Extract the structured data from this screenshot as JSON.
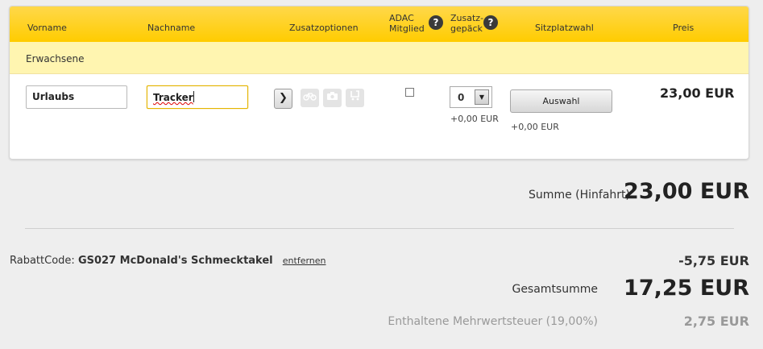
{
  "header": {
    "vorname": "Vorname",
    "nachname": "Nachname",
    "zusatzoptionen": "Zusatzoptionen",
    "adac_line1": "ADAC",
    "adac_line2": "Mitglied",
    "gepaeck_line1": "Zusatz-",
    "gepaeck_line2": "gepäck",
    "help_glyph": "?",
    "sitzplatzwahl": "Sitzplatzwahl",
    "preis": "Preis"
  },
  "section": {
    "label": "Erwachsene"
  },
  "passenger": {
    "vorname_value": "Urlaubs",
    "nachname_value": "Tracker",
    "more_options_glyph": "❯",
    "option_icons": [
      "bicycle-icon",
      "camera-icon",
      "stroller-icon"
    ],
    "adac_checked": false,
    "baggage_value": "0",
    "baggage_price": "+0,00 EUR",
    "seat_button": "Auswahl",
    "seat_price": "+0,00 EUR",
    "price": "23,00 EUR"
  },
  "summary": {
    "sum_label": "Summe (Hinfahrt)",
    "sum_value": "23,00 EUR",
    "rabatt_label": "RabattCode:",
    "rabatt_code": "GS027 McDonald's Schmecktakel",
    "rabatt_remove": "entfernen",
    "rabatt_value": "-5,75 EUR",
    "total_label": "Gesamtsumme",
    "total_value": "17,25 EUR",
    "vat_label": "Enthaltene Mehrwertsteuer (19,00%)",
    "vat_value": "2,75 EUR"
  },
  "colors": {
    "header_yellow": "#ffcc00",
    "section_yellow": "#fff5b0",
    "background": "#eeeeee"
  }
}
